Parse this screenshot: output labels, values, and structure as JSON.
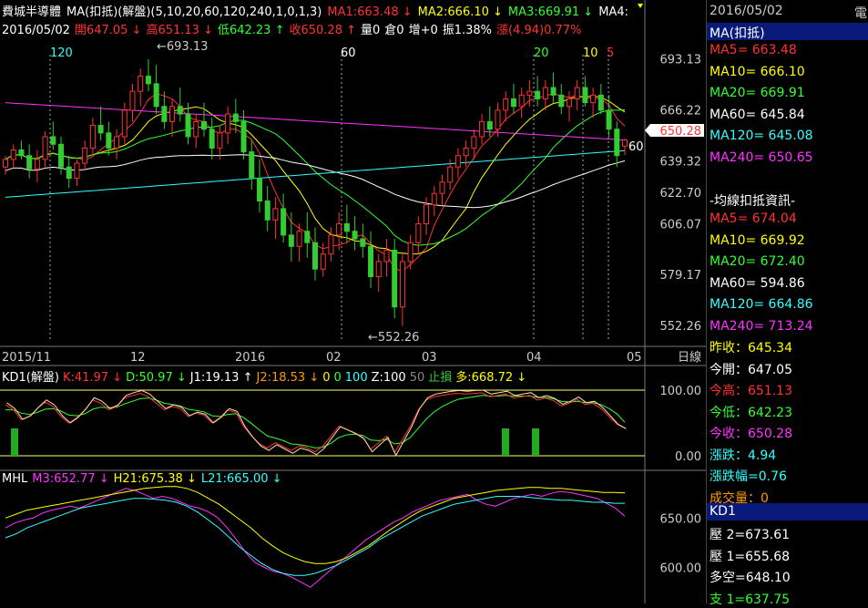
{
  "header": {
    "line1": [
      {
        "text": "費城半導體",
        "color": "#ffffff"
      },
      {
        "text": "MA(扣抵)(解盤)(5,10,20,60,120,240,1,0,1,3)",
        "color": "#ffffff"
      },
      {
        "text": "MA1:663.48 ↓",
        "color": "#ff3333"
      },
      {
        "text": "MA2:666.10 ↓",
        "color": "#ffff00"
      },
      {
        "text": "MA3:669.91 ↓",
        "color": "#33ff33"
      },
      {
        "text": "MA4:",
        "color": "#ffffff"
      }
    ],
    "line2": [
      {
        "text": "2016/05/02",
        "color": "#ffffff"
      },
      {
        "text": "開647.05 ↓",
        "color": "#ff3333"
      },
      {
        "text": "高651.13 ↓",
        "color": "#ff3333"
      },
      {
        "text": "低642.23 ↑",
        "color": "#33ff33"
      },
      {
        "text": "收650.28 ↑",
        "color": "#ff3333"
      },
      {
        "text": "量0",
        "color": "#ffffff"
      },
      {
        "text": "倉0",
        "color": "#ffffff"
      },
      {
        "text": "增+0",
        "color": "#ffffff"
      },
      {
        "text": "振1.38%",
        "color": "#ffffff"
      },
      {
        "text": "漲(4.94)0.77%",
        "color": "#ff3333"
      }
    ]
  },
  "annotations": {
    "high_label": "693.13",
    "low_label": "552.26",
    "count_120": "120",
    "count_60": "60",
    "count_20": "20",
    "count_10": "10",
    "count_5": "5",
    "right_60": "60"
  },
  "chart_data": [
    {
      "type": "candlestick",
      "title": "費城半導體",
      "date": "2016/05/02",
      "y_ticks": [
        693.13,
        666.22,
        639.32,
        622.7,
        606.07,
        579.17,
        552.26
      ],
      "ylim": [
        545,
        705
      ],
      "last_price": "650.28",
      "x_labels": [
        "2015/11",
        "12",
        "2016",
        "02",
        "03",
        "04",
        "05"
      ],
      "x_unit": "日線",
      "ohlc": [
        [
          636,
          642,
          632,
          640
        ],
        [
          640,
          648,
          636,
          645
        ],
        [
          645,
          650,
          640,
          642
        ],
        [
          642,
          648,
          630,
          635
        ],
        [
          635,
          645,
          628,
          640
        ],
        [
          640,
          655,
          636,
          652
        ],
        [
          652,
          660,
          645,
          648
        ],
        [
          648,
          652,
          632,
          636
        ],
        [
          636,
          642,
          625,
          630
        ],
        [
          630,
          640,
          626,
          638
        ],
        [
          638,
          650,
          634,
          646
        ],
        [
          646,
          662,
          642,
          658
        ],
        [
          658,
          668,
          650,
          654
        ],
        [
          654,
          660,
          642,
          646
        ],
        [
          646,
          656,
          640,
          652
        ],
        [
          652,
          670,
          648,
          666
        ],
        [
          666,
          680,
          660,
          676
        ],
        [
          676,
          688,
          668,
          684
        ],
        [
          684,
          693,
          676,
          680
        ],
        [
          680,
          690,
          664,
          668
        ],
        [
          668,
          676,
          656,
          660
        ],
        [
          660,
          672,
          652,
          668
        ],
        [
          668,
          678,
          660,
          664
        ],
        [
          664,
          670,
          648,
          652
        ],
        [
          652,
          664,
          646,
          660
        ],
        [
          660,
          670,
          652,
          656
        ],
        [
          656,
          662,
          640,
          646
        ],
        [
          646,
          658,
          640,
          654
        ],
        [
          654,
          668,
          648,
          664
        ],
        [
          664,
          672,
          654,
          660
        ],
        [
          660,
          666,
          640,
          644
        ],
        [
          644,
          650,
          624,
          630
        ],
        [
          630,
          640,
          612,
          618
        ],
        [
          618,
          626,
          602,
          608
        ],
        [
          608,
          620,
          598,
          614
        ],
        [
          614,
          622,
          596,
          600
        ],
        [
          600,
          612,
          586,
          594
        ],
        [
          594,
          606,
          586,
          602
        ],
        [
          602,
          612,
          588,
          596
        ],
        [
          596,
          604,
          576,
          582
        ],
        [
          582,
          596,
          578,
          590
        ],
        [
          590,
          604,
          586,
          600
        ],
        [
          600,
          612,
          592,
          606
        ],
        [
          606,
          616,
          596,
          602
        ],
        [
          602,
          610,
          592,
          598
        ],
        [
          598,
          606,
          588,
          594
        ],
        [
          594,
          602,
          572,
          578
        ],
        [
          578,
          590,
          570,
          586
        ],
        [
          586,
          598,
          578,
          592
        ],
        [
          592,
          598,
          556,
          562
        ],
        [
          562,
          590,
          552,
          586
        ],
        [
          586,
          600,
          582,
          596
        ],
        [
          596,
          610,
          590,
          606
        ],
        [
          606,
          620,
          600,
          616
        ],
        [
          616,
          626,
          610,
          622
        ],
        [
          622,
          632,
          616,
          628
        ],
        [
          628,
          640,
          624,
          636
        ],
        [
          636,
          646,
          630,
          642
        ],
        [
          642,
          650,
          636,
          646
        ],
        [
          646,
          656,
          640,
          652
        ],
        [
          652,
          664,
          648,
          660
        ],
        [
          660,
          668,
          652,
          656
        ],
        [
          656,
          670,
          652,
          666
        ],
        [
          666,
          676,
          660,
          672
        ],
        [
          672,
          680,
          664,
          668
        ],
        [
          668,
          678,
          662,
          674
        ],
        [
          674,
          682,
          668,
          676
        ],
        [
          676,
          684,
          668,
          672
        ],
        [
          672,
          682,
          666,
          678
        ],
        [
          678,
          686,
          670,
          674
        ],
        [
          674,
          680,
          664,
          668
        ],
        [
          668,
          676,
          660,
          672
        ],
        [
          672,
          682,
          666,
          678
        ],
        [
          678,
          684,
          668,
          670
        ],
        [
          670,
          678,
          662,
          674
        ],
        [
          674,
          680,
          664,
          666
        ],
        [
          666,
          674,
          652,
          656
        ],
        [
          656,
          660,
          636,
          642
        ],
        [
          647.05,
          651.13,
          642.23,
          650.28
        ]
      ]
    },
    {
      "type": "line",
      "title": "KD1(解盤)",
      "y_ticks": [
        100.0,
        0.0
      ],
      "ylim": [
        0,
        100
      ],
      "legend": [
        {
          "text": "KD1(解盤)",
          "color": "#ffffff"
        },
        {
          "text": "K:41.97 ↓",
          "color": "#ff3333"
        },
        {
          "text": "D:50.97 ↓",
          "color": "#33ff33"
        },
        {
          "text": "J1:19.13 ↑",
          "color": "#ffffff"
        },
        {
          "text": "J2:18.53 ↓",
          "color": "#ff9900"
        },
        {
          "text": "0",
          "color": "#ffff00"
        },
        {
          "text": "0",
          "color": "#33ff33"
        },
        {
          "text": "100",
          "color": "#33ffff"
        },
        {
          "text": "Z:100",
          "color": "#ffffff"
        },
        {
          "text": "50",
          "color": "#888888"
        },
        {
          "text": "止損",
          "color": "#33cc33"
        },
        {
          "text": "多:668.72 ↓",
          "color": "#ffff00"
        }
      ],
      "k": [
        78,
        70,
        55,
        60,
        72,
        82,
        75,
        60,
        50,
        58,
        70,
        85,
        80,
        70,
        75,
        88,
        92,
        95,
        90,
        80,
        70,
        75,
        72,
        60,
        65,
        62,
        50,
        58,
        70,
        66,
        45,
        30,
        18,
        12,
        20,
        14,
        8,
        15,
        12,
        6,
        15,
        30,
        45,
        40,
        35,
        28,
        10,
        20,
        30,
        5,
        25,
        45,
        70,
        85,
        90,
        92,
        94,
        95,
        94,
        95,
        96,
        90,
        92,
        94,
        88,
        90,
        92,
        85,
        88,
        84,
        76,
        80,
        86,
        78,
        80,
        72,
        60,
        48,
        42
      ],
      "d": [
        70,
        70,
        65,
        63,
        66,
        71,
        72,
        68,
        62,
        61,
        64,
        71,
        74,
        73,
        74,
        79,
        83,
        87,
        88,
        85,
        80,
        78,
        76,
        71,
        69,
        67,
        61,
        60,
        63,
        64,
        58,
        49,
        39,
        30,
        27,
        23,
        18,
        17,
        15,
        12,
        13,
        19,
        28,
        32,
        33,
        31,
        24,
        23,
        25,
        18,
        20,
        28,
        42,
        56,
        67,
        75,
        81,
        86,
        88,
        90,
        92,
        91,
        91,
        92,
        91,
        91,
        91,
        89,
        89,
        87,
        83,
        82,
        83,
        81,
        81,
        78,
        72,
        64,
        51
      ]
    },
    {
      "type": "line",
      "title": "MHL",
      "y_ticks": [
        650.0,
        600.0
      ],
      "ylim": [
        570,
        690
      ],
      "legend": [
        {
          "text": "MHL",
          "color": "#ffffff"
        },
        {
          "text": "M3:652.77 ↓",
          "color": "#ff33ff"
        },
        {
          "text": "H21:675.38 ↓",
          "color": "#ffff00"
        },
        {
          "text": "L21:665.00 ↓",
          "color": "#33ffff"
        }
      ],
      "m3": [
        640,
        645,
        648,
        650,
        655,
        658,
        660,
        662,
        660,
        664,
        668,
        672,
        676,
        680,
        678,
        674,
        670,
        672,
        670,
        666,
        662,
        660,
        656,
        650,
        640,
        628,
        615,
        605,
        600,
        596,
        594,
        590,
        585,
        580,
        588,
        596,
        604,
        612,
        620,
        628,
        634,
        640,
        646,
        650,
        656,
        660,
        664,
        668,
        670,
        672,
        674,
        668,
        664,
        662,
        666,
        670,
        672,
        674,
        672,
        675,
        677,
        676,
        674,
        672,
        670,
        665,
        660,
        652
      ],
      "h21": [
        650,
        654,
        658,
        660,
        662,
        664,
        666,
        668,
        670,
        672,
        674,
        676,
        678,
        680,
        681,
        682,
        682,
        680,
        676,
        670,
        664,
        656,
        648,
        640,
        630,
        622,
        615,
        610,
        606,
        604,
        604,
        606,
        610,
        616,
        622,
        630,
        638,
        645,
        652,
        658,
        662,
        666,
        670,
        672,
        674,
        676,
        678,
        679,
        680,
        681,
        681,
        680,
        680,
        679,
        678,
        677,
        676,
        676,
        675.38
      ],
      "l21": [
        630,
        634,
        640,
        644,
        648,
        652,
        656,
        660,
        662,
        664,
        666,
        668,
        670,
        670,
        669,
        668,
        666,
        662,
        656,
        648,
        640,
        630,
        620,
        612,
        604,
        598,
        594,
        592,
        592,
        594,
        598,
        602,
        608,
        614,
        620,
        628,
        634,
        640,
        646,
        652,
        656,
        660,
        664,
        666,
        668,
        670,
        672,
        672,
        672,
        671,
        670,
        669,
        668,
        668,
        667,
        666,
        666,
        665,
        665.0
      ]
    }
  ],
  "sidebar": {
    "date": "2016/05/02",
    "corner": "電",
    "ma_header": "MA(扣抵)",
    "ma_rows": [
      {
        "text": "MA5= 663.48",
        "color": "#ff3333"
      },
      {
        "text": "MA10= 666.10",
        "color": "#ffff00"
      },
      {
        "text": "MA20= 669.91",
        "color": "#33ff33"
      },
      {
        "text": "MA60= 645.84",
        "color": "#ffffff"
      },
      {
        "text": "MA120= 645.08",
        "color": "#33ffff"
      },
      {
        "text": "MA240= 650.65",
        "color": "#ff33ff"
      }
    ],
    "deduct_header": "-均線扣抵資訊-",
    "deduct_rows": [
      {
        "text": "MA5= 674.04",
        "color": "#ff3333"
      },
      {
        "text": "MA10= 669.92",
        "color": "#ffff00"
      },
      {
        "text": "MA20= 672.40",
        "color": "#33ff33"
      },
      {
        "text": "MA60= 594.86",
        "color": "#ffffff"
      },
      {
        "text": "MA120= 664.86",
        "color": "#33ffff"
      },
      {
        "text": "MA240= 713.24",
        "color": "#ff33ff"
      }
    ],
    "quote_rows": [
      {
        "text": "昨收：645.34",
        "color": "#ffff00"
      },
      {
        "text": "今開：647.05",
        "color": "#ffffff"
      },
      {
        "text": "今高：651.13",
        "color": "#ff3333"
      },
      {
        "text": "今低：642.23",
        "color": "#33ff33"
      },
      {
        "text": "今收：650.28",
        "color": "#ff33ff"
      },
      {
        "text": "漲跌：4.94",
        "color": "#33ffff"
      },
      {
        "text": "漲跌幅=0.76",
        "color": "#33ffff"
      },
      {
        "text": "成交量：0",
        "color": "#ff9900"
      }
    ],
    "kd_header": "KD1",
    "kd_rows": [
      {
        "text": "壓 2=673.61",
        "color": "#ffffff"
      },
      {
        "text": "壓 1=655.68",
        "color": "#ffffff"
      },
      {
        "text": "多空=648.10",
        "color": "#ffffff"
      },
      {
        "text": "支 1=637.75",
        "color": "#33ff33"
      }
    ]
  }
}
